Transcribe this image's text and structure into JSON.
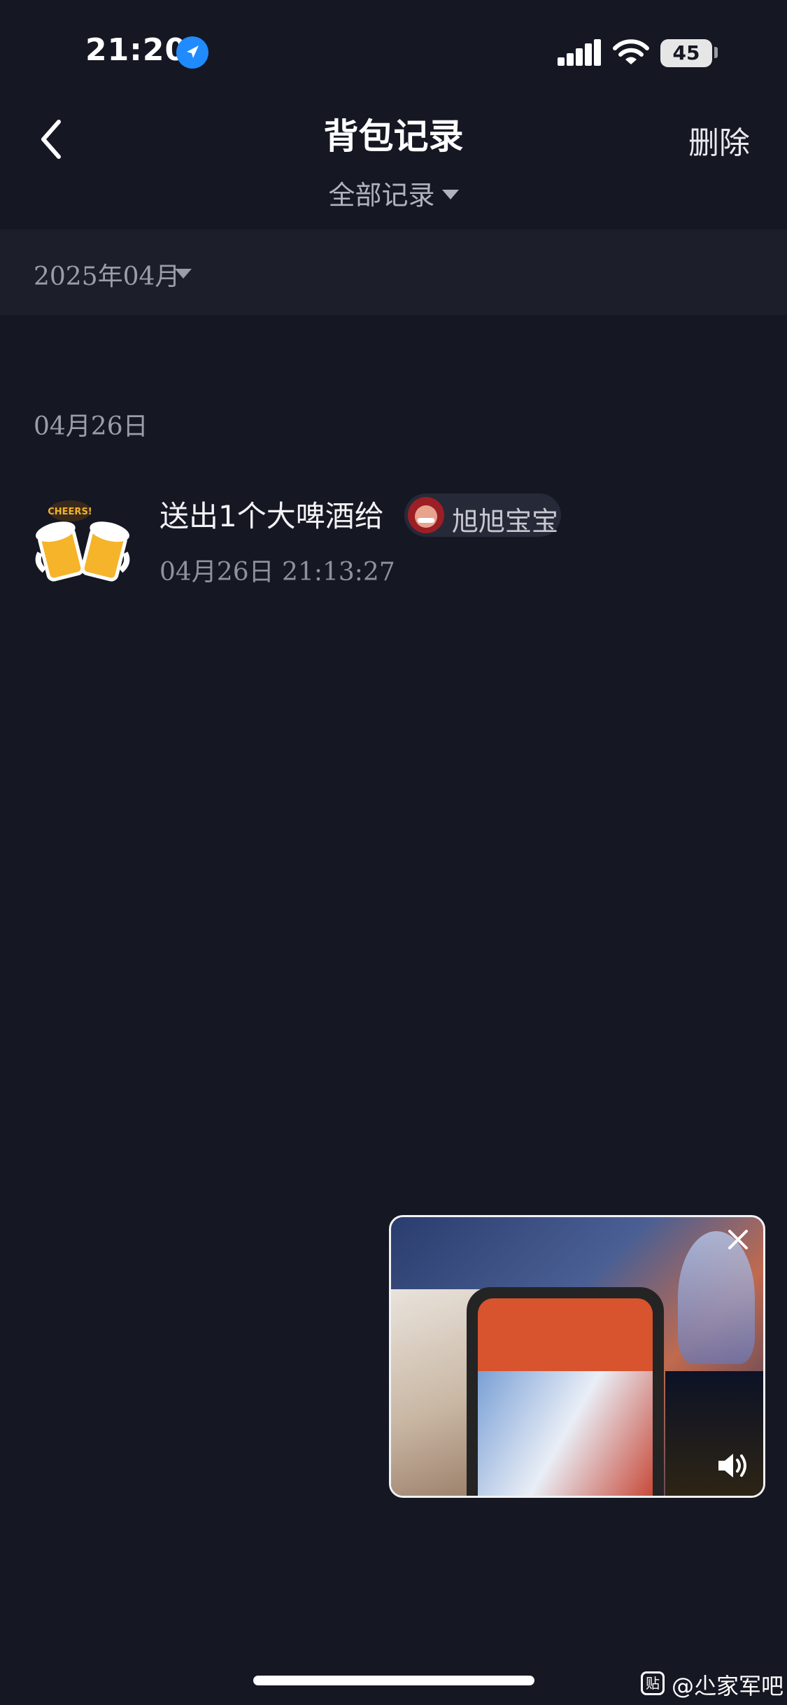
{
  "status_bar": {
    "time": "21:20",
    "battery": "45"
  },
  "nav": {
    "title": "背包记录",
    "delete_label": "删除",
    "filter_label": "全部记录"
  },
  "month_selector": {
    "label": "2025年04月"
  },
  "records": {
    "date_heading": "04月26日",
    "item": {
      "text": "送出1个大啤酒给",
      "recipient": "旭旭宝宝",
      "time": "04月26日 21:13:27",
      "icon_text": "CHEERS!"
    }
  },
  "watermark": {
    "icon": "贴",
    "text": "@尐家军吧"
  },
  "colors": {
    "background": "#151723",
    "month_bar": "#1c1f2a",
    "accent_blue": "#1f8bff"
  }
}
